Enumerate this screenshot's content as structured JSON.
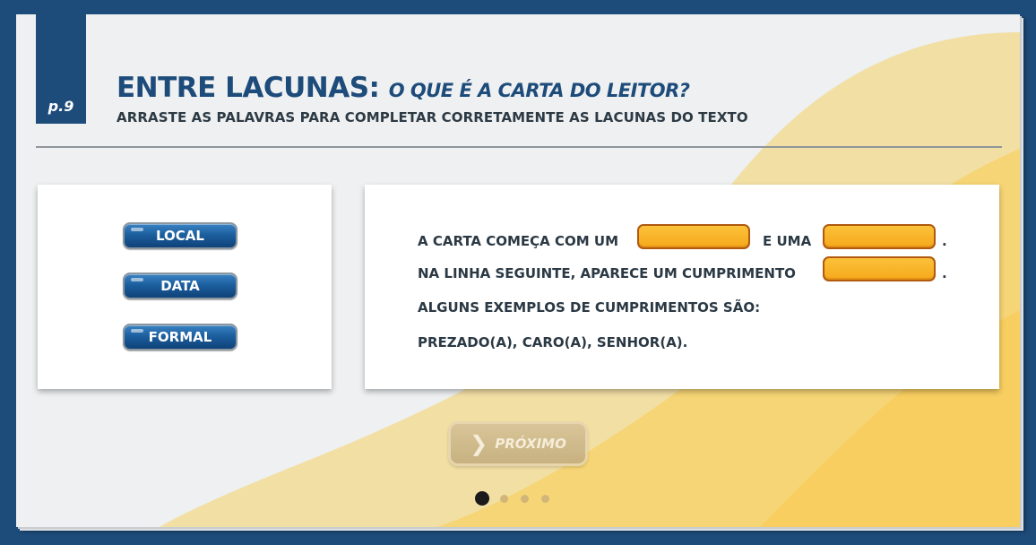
{
  "header": {
    "page_label": "p.9",
    "title_main": "ENTRE LACUNAS:",
    "title_sub": "O QUE É A CARTA DO LEITOR?",
    "instruction": "ARRASTE AS PALAVRAS PARA COMPLETAR CORRETAMENTE AS LACUNAS DO TEXTO"
  },
  "word_bank": {
    "words": [
      {
        "label": "LOCAL"
      },
      {
        "label": "DATA"
      },
      {
        "label": "FORMAL"
      }
    ]
  },
  "text": {
    "line1_a": "A CARTA COMEÇA COM UM",
    "line1_b": "E UMA",
    "line1_end": ".",
    "line2_a": "NA LINHA SEGUINTE, APARECE UM CUMPRIMENTO",
    "line2_end": ".",
    "line3": "ALGUNS EXEMPLOS DE CUMPRIMENTOS SÃO:",
    "line4": "PREZADO(A), CARO(A), SENHOR(A)."
  },
  "navigation": {
    "next_label": "PRÓXIMO",
    "next_icon": "chevron-right-icon",
    "dots": {
      "total": 4,
      "active": 1
    }
  },
  "colors": {
    "frame": "#1d4b7a",
    "title": "#1d4b7a",
    "word_button": "#1c5f9f",
    "blank_fill": "#f6a81b",
    "blank_border": "#b0590f",
    "background_wave": "#f6d97a"
  }
}
